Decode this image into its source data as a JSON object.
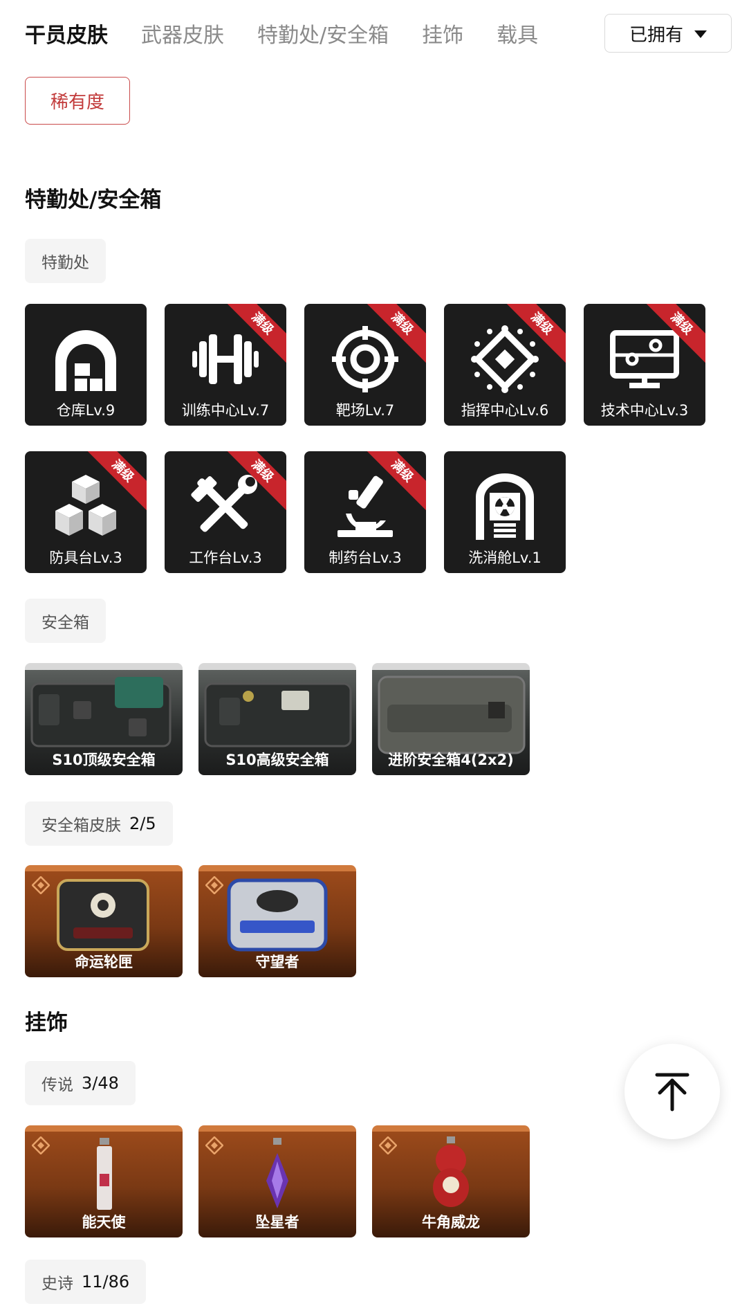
{
  "tabs": [
    {
      "label": "干员皮肤",
      "active": true
    },
    {
      "label": "武器皮肤",
      "active": false
    },
    {
      "label": "特勤处/安全箱",
      "active": false
    },
    {
      "label": "挂饰",
      "active": false
    },
    {
      "label": "载具",
      "active": false
    }
  ],
  "owned_filter": {
    "label": "已拥有",
    "icon": "caret-down-icon"
  },
  "rarity_button": "稀有度",
  "sections": {
    "facility_title": "特勤处/安全箱",
    "facility_chip": "特勤处",
    "facilities": [
      {
        "label": "仓库Lv.9",
        "icon": "warehouse-icon",
        "max": false
      },
      {
        "label": "训练中心Lv.7",
        "icon": "barbell-icon",
        "max": true
      },
      {
        "label": "靶场Lv.7",
        "icon": "target-icon",
        "max": true
      },
      {
        "label": "指挥中心Lv.6",
        "icon": "chip-icon",
        "max": true
      },
      {
        "label": "技术中心Lv.3",
        "icon": "monitor-icon",
        "max": true
      },
      {
        "label": "防具台Lv.3",
        "icon": "cubes-icon",
        "max": true
      },
      {
        "label": "工作台Lv.3",
        "icon": "tools-icon",
        "max": true
      },
      {
        "label": "制药台Lv.3",
        "icon": "microscope-icon",
        "max": true
      },
      {
        "label": "洗消舱Lv.1",
        "icon": "decontamination-icon",
        "max": false
      }
    ],
    "max_badge": "满级",
    "safebox_chip": "安全箱",
    "safeboxes": [
      {
        "label": "S10顶级安全箱"
      },
      {
        "label": "S10高级安全箱"
      },
      {
        "label": "进阶安全箱4(2x2)"
      }
    ],
    "safebox_skin_chip": {
      "label": "安全箱皮肤",
      "count": "2/5"
    },
    "safebox_skins": [
      {
        "label": "命运轮匣"
      },
      {
        "label": "守望者"
      }
    ],
    "charm_title": "挂饰",
    "legend_chip": {
      "label": "传说",
      "count": "3/48"
    },
    "legend_charms": [
      {
        "label": "能天使"
      },
      {
        "label": "坠星者"
      },
      {
        "label": "牛角威龙"
      }
    ],
    "epic_chip": {
      "label": "史诗",
      "count": "11/86"
    }
  },
  "back_to_top": {
    "icon": "arrow-up-to-top-icon"
  },
  "colors": {
    "accent_red": "#c8252c",
    "tile_bg": "#1c1c1c",
    "card_orange": "#9b4a1b"
  }
}
